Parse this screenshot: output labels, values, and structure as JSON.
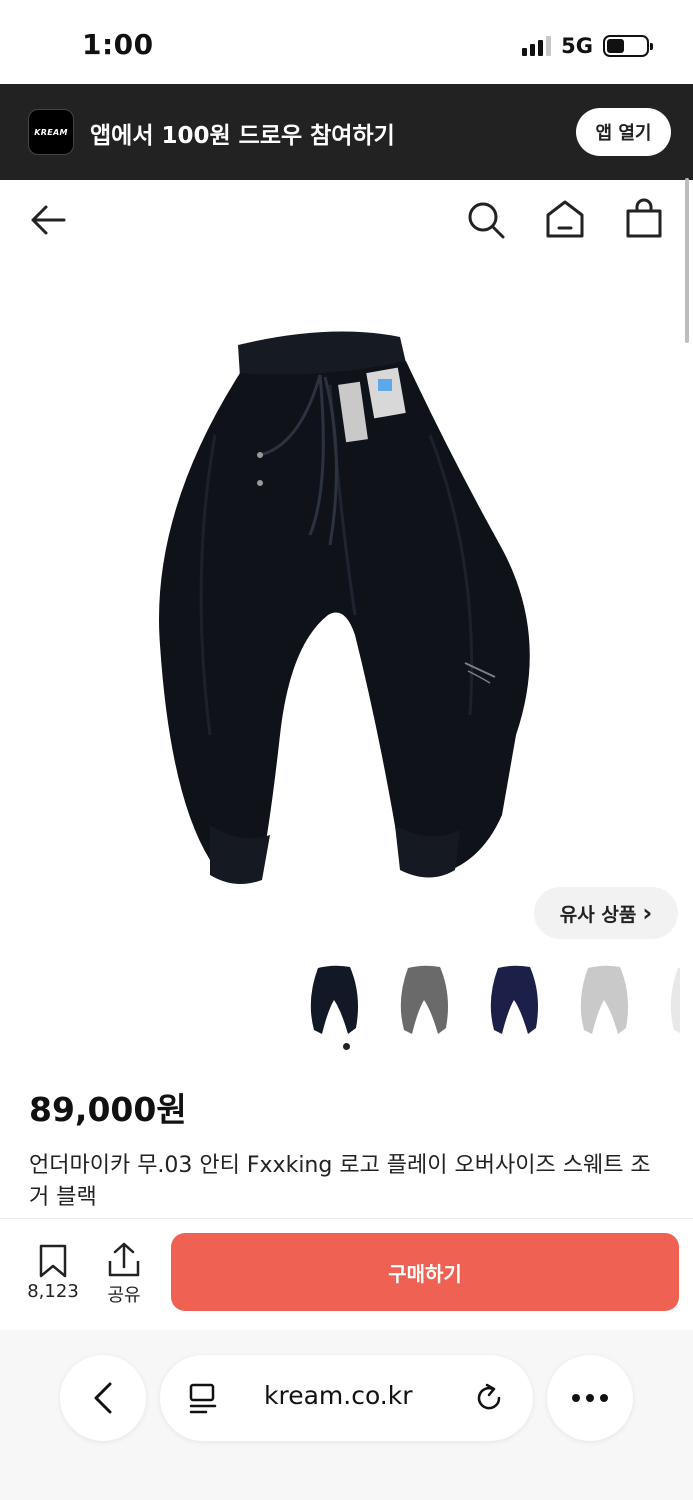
{
  "status_bar": {
    "time": "1:00",
    "network": "5G"
  },
  "banner": {
    "logo_text": "KREAM",
    "text": "앱에서 100원 드로우 참여하기",
    "button": "앱 열기"
  },
  "header": {
    "icons": [
      "back-arrow-icon",
      "search-icon",
      "home-icon",
      "shopping-bag-icon"
    ]
  },
  "similar_button": {
    "label": "유사 상품",
    "chevron": "›"
  },
  "thumbnails": [
    {
      "color": "#121826"
    },
    {
      "color": "#6a6a6a"
    },
    {
      "color": "#1c2048"
    },
    {
      "color": "#c9c9c9"
    },
    {
      "color": "#e8e8e8"
    }
  ],
  "product": {
    "price": "89,000원",
    "name": "언더마이카 무.03 안티 Fxxking 로고 플레이 오버사이즈 스웨트 조거 블랙"
  },
  "actions": {
    "wish_count": "8,123",
    "share_label": "공유",
    "buy_label": "구매하기"
  },
  "browser": {
    "url": "kream.co.kr"
  },
  "colors": {
    "accent": "#ef6253",
    "banner_bg": "#222222"
  }
}
